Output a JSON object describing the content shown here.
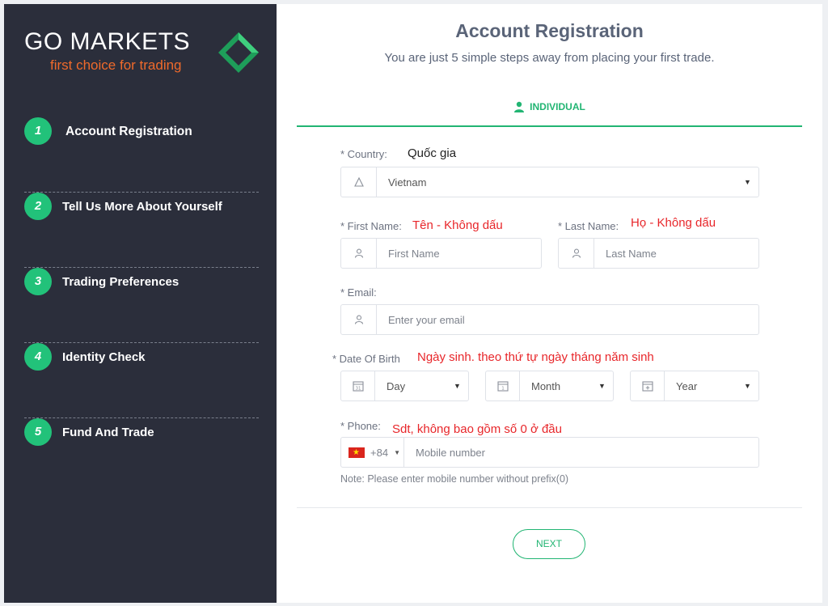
{
  "brand": {
    "name": "GO MARKETS",
    "tagline": "first choice for trading"
  },
  "steps": [
    {
      "num": "1",
      "label": "Account Registration"
    },
    {
      "num": "2",
      "label": "Tell Us More About Yourself"
    },
    {
      "num": "3",
      "label": "Trading Preferences"
    },
    {
      "num": "4",
      "label": "Identity Check"
    },
    {
      "num": "5",
      "label": "Fund And Trade"
    }
  ],
  "header": {
    "title": "Account Registration",
    "subtitle": "You are just 5 simple steps away from placing your first trade."
  },
  "tab": {
    "label": "INDIVIDUAL",
    "color": "#22b573"
  },
  "form": {
    "country": {
      "label": "* Country:",
      "value": "Vietnam",
      "note": "Quốc gia"
    },
    "first_name": {
      "label": "* First Name:",
      "placeholder": "First Name",
      "note": "Tên - Không dấu"
    },
    "last_name": {
      "label": "* Last Name:",
      "placeholder": "Last Name",
      "note": "Họ - Không dấu"
    },
    "email": {
      "label": "* Email:",
      "placeholder": "Enter your email"
    },
    "dob": {
      "label": "* Date Of Birth",
      "note": "Ngày sinh. theo thứ tự ngày tháng năm sinh",
      "day": "Day",
      "month": "Month",
      "year": "Year"
    },
    "phone": {
      "label": "* Phone:",
      "prefix": "+84",
      "placeholder": "Mobile number",
      "note": "Sdt, không bao gồm số 0 ở đầu",
      "hint": "Note: Please enter mobile number without prefix(0)"
    }
  },
  "actions": {
    "next_label": "NEXT"
  },
  "colors": {
    "sidebar": "#2b2e3b",
    "accent": "#22b573",
    "step_badge": "#22c27a",
    "tagline": "#ef6a2b",
    "annotation": "#e8262a"
  }
}
